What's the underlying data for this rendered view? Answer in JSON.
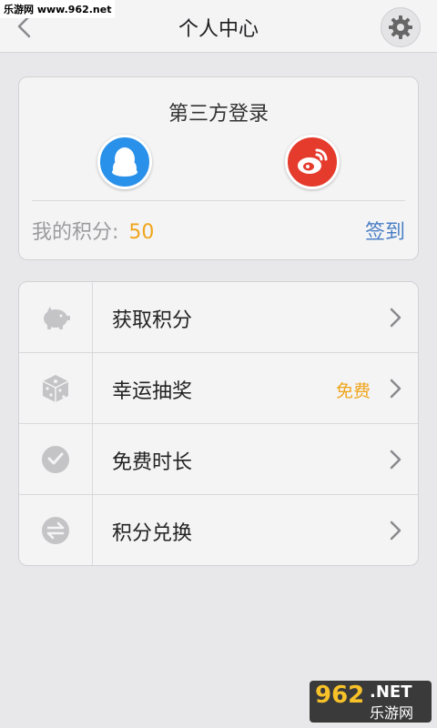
{
  "watermark": {
    "top_text": "乐游网 www.962.net",
    "bottom_num": "962",
    "bottom_net": ".NET",
    "bottom_cn": "乐游网"
  },
  "header": {
    "title": "个人中心",
    "back_icon": "chevron-left-icon",
    "settings_icon": "gear-icon"
  },
  "login": {
    "title": "第三方登录",
    "providers": [
      {
        "name": "qq",
        "icon": "qq-penguin-icon",
        "color": "#2a91ea"
      },
      {
        "name": "weibo",
        "icon": "weibo-icon",
        "color": "#e53b2c"
      }
    ],
    "points_label": "我的积分:",
    "points_value": "50",
    "checkin_label": "签到"
  },
  "menu": {
    "items": [
      {
        "label": "获取积分",
        "icon": "piggy-bank-icon",
        "badge": ""
      },
      {
        "label": "幸运抽奖",
        "icon": "dice-icon",
        "badge": "免费"
      },
      {
        "label": "免费时长",
        "icon": "clock-icon",
        "badge": ""
      },
      {
        "label": "积分兑换",
        "icon": "exchange-icon",
        "badge": ""
      }
    ]
  },
  "colors": {
    "accent_orange": "#f0a51b",
    "link_blue": "#4a7fc5",
    "icon_gray": "#c4c4c7"
  }
}
